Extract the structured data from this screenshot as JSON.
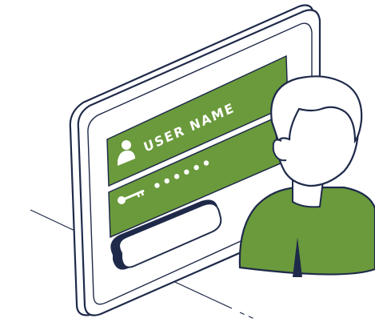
{
  "illustration": {
    "username_label": "USER NAME",
    "password_mask": "••••••",
    "user_icon": "user-icon",
    "key_icon": "key-icon",
    "person_icon": "person-avatar-icon"
  },
  "colors": {
    "outline": "#1f2a4a",
    "accent_green": "#6a9a3c",
    "panel_fill": "#ffffff",
    "skin": "#ffffff"
  }
}
